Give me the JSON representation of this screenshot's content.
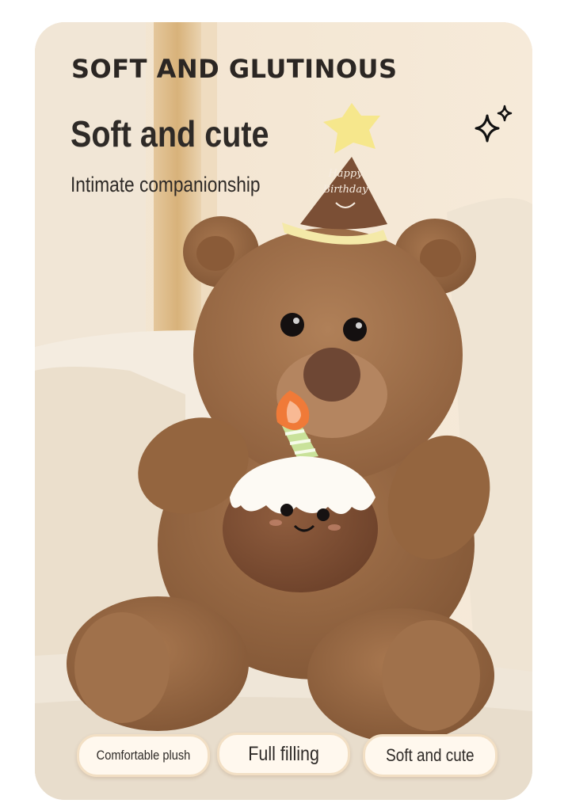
{
  "header": {
    "headline": "SOFT AND GLUTINOUS",
    "subtitle": "Soft and cute",
    "tagline": "Intimate companionship"
  },
  "decor": {
    "sparkle_icon": "sparkle-icon"
  },
  "product": {
    "hat_text": "Happy Birthday",
    "photo_subject": "brown-teddy-bear"
  },
  "features": [
    {
      "label": "Comfortable plush"
    },
    {
      "label": "Full filling"
    },
    {
      "label": "Soft and cute"
    }
  ],
  "colors": {
    "bear_fur": "#9a6a45",
    "background": "#efe1cc",
    "headline_text": "#2b2623",
    "chip_background": "#fff8ee"
  }
}
